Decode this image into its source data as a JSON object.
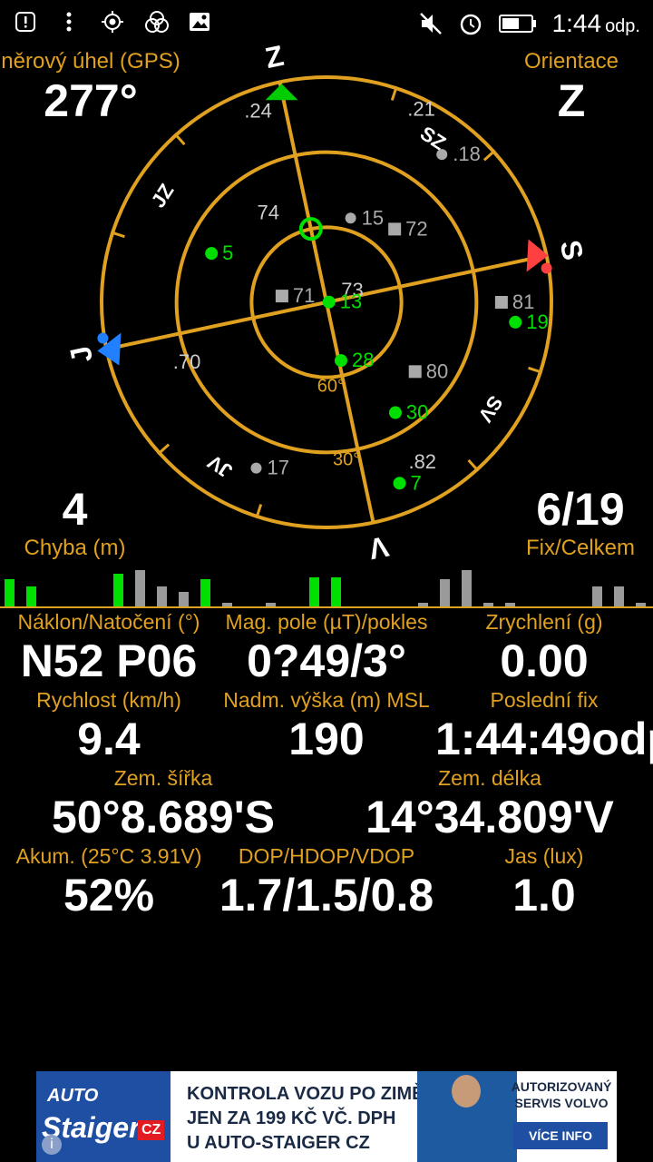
{
  "status_bar": {
    "time": "1:44",
    "ampm": "odp.",
    "icons": [
      "alert-icon",
      "more-vert-icon",
      "gps-icon",
      "circles-icon",
      "image-icon",
      "mute-icon",
      "alarm-icon",
      "battery-icon"
    ]
  },
  "corners": {
    "bearing_label": "něrový úhel (GPS)",
    "bearing_value": "277°",
    "orientation_label": "Orientace",
    "orientation_value": "Z",
    "error_value": "4",
    "error_label": "Chyba (m)",
    "fix_value": "6/19",
    "fix_label": "Fix/Celkem"
  },
  "sky": {
    "directions": {
      "top": "Z",
      "right": "S",
      "bottom": "V",
      "left": "J",
      "ne": "SZ",
      "se": "SV",
      "sw": "JV",
      "nw": "JZ"
    },
    "elevation_labels": [
      "60°",
      "30°"
    ],
    "satellites": [
      {
        "id": ".24",
        "az": 346,
        "el": 5,
        "state": "none"
      },
      {
        "id": ".21",
        "az": 32,
        "el": 8,
        "state": "none"
      },
      {
        "id": ".18",
        "az": 50,
        "el": 15,
        "state": "unused"
      },
      {
        "id": "74",
        "az": 330,
        "el": 42,
        "state": "none"
      },
      {
        "id": "15",
        "az": 28,
        "el": 55,
        "state": "unused"
      },
      {
        "id": "72",
        "az": 55,
        "el": 50,
        "state": "glonass"
      },
      {
        "id": "",
        "az": 0,
        "el": 60,
        "state": "fix-ring"
      },
      {
        "id": "5",
        "az": 305,
        "el": 40,
        "state": "used"
      },
      {
        "id": "71",
        "az": 290,
        "el": 72,
        "state": "glonass"
      },
      {
        "id": "73",
        "az": 30,
        "el": 85,
        "state": "none"
      },
      {
        "id": "13",
        "az": 96,
        "el": 89,
        "state": "used"
      },
      {
        "id": ".70",
        "az": 262,
        "el": 20,
        "state": "none"
      },
      {
        "id": "81",
        "az": 102,
        "el": 20,
        "state": "glonass"
      },
      {
        "id": "19",
        "az": 108,
        "el": 14,
        "state": "used"
      },
      {
        "id": "28",
        "az": 178,
        "el": 66,
        "state": "used"
      },
      {
        "id": "80",
        "az": 140,
        "el": 45,
        "state": "glonass"
      },
      {
        "id": "30",
        "az": 160,
        "el": 38,
        "state": "used"
      },
      {
        "id": ".82",
        "az": 168,
        "el": 20,
        "state": "none"
      },
      {
        "id": "17",
        "az": 215,
        "el": 18,
        "state": "unused"
      },
      {
        "id": "7",
        "az": 170,
        "el": 12,
        "state": "used"
      }
    ]
  },
  "signal_bars": [
    {
      "h": 30,
      "used": true
    },
    {
      "h": 22,
      "used": true
    },
    {
      "h": 0,
      "used": false
    },
    {
      "h": 0,
      "used": false
    },
    {
      "h": 0,
      "used": false
    },
    {
      "h": 36,
      "used": true
    },
    {
      "h": 40,
      "used": false
    },
    {
      "h": 22,
      "used": false
    },
    {
      "h": 16,
      "used": false
    },
    {
      "h": 30,
      "used": true
    },
    {
      "h": 4,
      "used": false
    },
    {
      "h": 0,
      "used": false
    },
    {
      "h": 4,
      "used": false
    },
    {
      "h": 0,
      "used": false
    },
    {
      "h": 32,
      "used": true
    },
    {
      "h": 32,
      "used": true
    },
    {
      "h": 0,
      "used": false
    },
    {
      "h": 0,
      "used": false
    },
    {
      "h": 0,
      "used": false
    },
    {
      "h": 4,
      "used": false
    },
    {
      "h": 30,
      "used": false
    },
    {
      "h": 40,
      "used": false
    },
    {
      "h": 4,
      "used": false
    },
    {
      "h": 4,
      "used": false
    },
    {
      "h": 0,
      "used": false
    },
    {
      "h": 0,
      "used": false
    },
    {
      "h": 0,
      "used": false
    },
    {
      "h": 22,
      "used": false
    },
    {
      "h": 22,
      "used": false
    },
    {
      "h": 4,
      "used": false
    }
  ],
  "readings": [
    {
      "label": "Náklon/Natočení (°)",
      "value": "N52 P06"
    },
    {
      "label": "Mag. pole (µT)/pokles",
      "value": "0?49/3°"
    },
    {
      "label": "Zrychlení (g)",
      "value": "0.00"
    },
    {
      "label": "Rychlost (km/h)",
      "value": "9.4"
    },
    {
      "label": "Nadm. výška (m) MSL",
      "value": "190"
    },
    {
      "label": "Poslední fix",
      "value": "1:44:49odp"
    },
    {
      "label": "Zem. šířka",
      "value": "50°8.689'S"
    },
    {
      "label": "Zem. délka",
      "value": "14°34.809'V"
    },
    {
      "label": "Akum. (25°C 3.91V)",
      "value": "52%"
    },
    {
      "label": "DOP/HDOP/VDOP",
      "value": "1.7/1.5/0.8"
    },
    {
      "label": "Jas (lux)",
      "value": "1.0"
    }
  ],
  "ad": {
    "logo_auto": "AUTO",
    "logo_staiger": "Staiger",
    "logo_cz": "CZ",
    "line1": "KONTROLA VOZU PO ZIMĚ",
    "line2": "JEN ZA 199 KČ VČ. DPH",
    "line3": "U AUTO-STAIGER CZ",
    "right_line1": "AUTORIZOVANÝ",
    "right_line2": "SERVIS VOLVO",
    "button": "VÍCE INFO",
    "info_icon_label": "i"
  },
  "colors": {
    "accent": "#e0a020",
    "used": "#00e000",
    "unused": "#aaaaaa",
    "background": "#000000",
    "south_arrow": "#ff4040",
    "bearing_arrow": "#2080ff"
  }
}
